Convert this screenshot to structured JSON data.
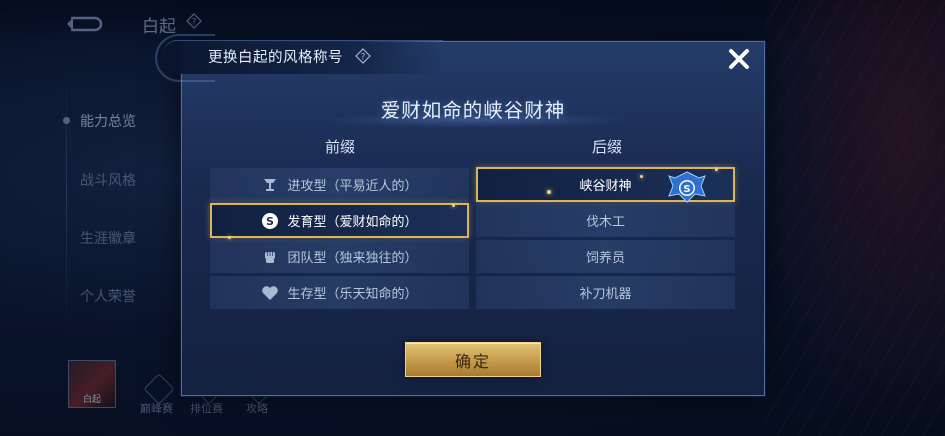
{
  "background": {
    "hero_name": "白起",
    "side_nav": [
      {
        "label": "能力总览",
        "active": true
      },
      {
        "label": "战斗风格",
        "active": false
      },
      {
        "label": "生涯徽章",
        "active": false
      },
      {
        "label": "个人荣誉",
        "active": false
      }
    ],
    "avatar_label": "白起",
    "bottom_tabs": [
      "巅峰赛",
      "排位赛",
      "攻略"
    ]
  },
  "modal": {
    "heading": "更换白起的风格称号",
    "current_title": "爱财如命的峡谷财神",
    "prefix_header": "前缀",
    "suffix_header": "后缀",
    "prefixes": [
      {
        "label": "进攻型（平易近人的）",
        "icon": "tower-icon",
        "selected": false
      },
      {
        "label": "发育型（爱财如命的）",
        "icon": "coin-icon",
        "selected": true
      },
      {
        "label": "团队型（独来独往的）",
        "icon": "fist-icon",
        "selected": false
      },
      {
        "label": "生存型（乐天知命的）",
        "icon": "heart-icon",
        "selected": false
      }
    ],
    "suffixes": [
      {
        "label": "峡谷财神",
        "selected": true
      },
      {
        "label": "伐木工",
        "selected": false
      },
      {
        "label": "饲养员",
        "selected": false
      },
      {
        "label": "补刀机器",
        "selected": false
      }
    ],
    "confirm_label": "确定"
  },
  "colors": {
    "accent_gold": "#d9b35e",
    "panel_bg": "#1b2d56",
    "text_primary": "#e7eefb"
  }
}
